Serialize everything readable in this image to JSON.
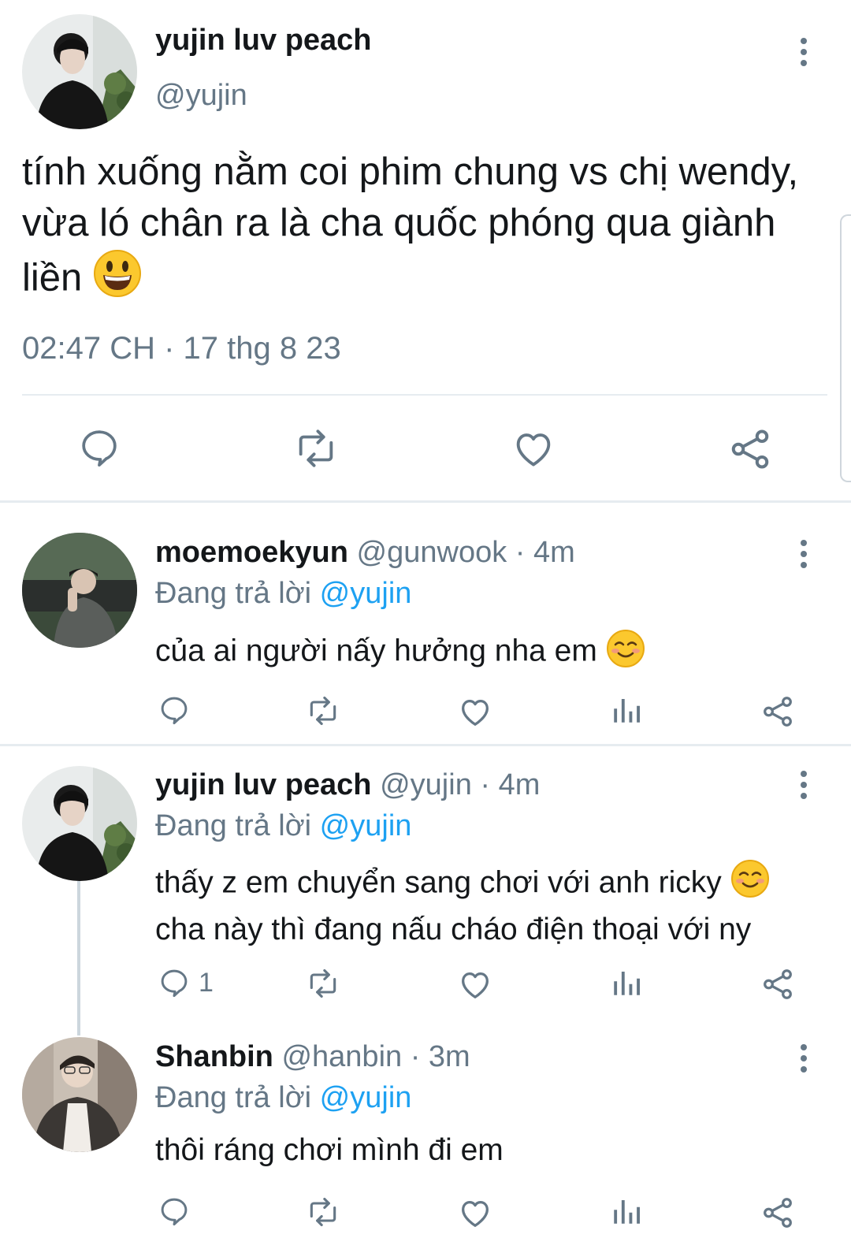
{
  "main_tweet": {
    "display_name": "yujin luv peach",
    "handle": "@yujin",
    "text": "tính xuống nằm coi phim chung vs chị wendy, vừa ló chân ra là cha quốc phóng qua giành liền",
    "emoji": "grinning-face",
    "timestamp": "02:47 CH · 17 thg 8 23"
  },
  "replies": [
    {
      "display_name": "moemoekyun",
      "handle": "@gunwook",
      "time": "· 4m",
      "replying_prefix": "Đang trả lời",
      "replying_to": "@yujin",
      "text": "của ai người nấy hưởng nha em",
      "emoji": "smiling-face",
      "reply_count": ""
    },
    {
      "display_name": "yujin luv peach",
      "handle": "@yujin",
      "time": "· 4m",
      "replying_prefix": "Đang trả lời",
      "replying_to": "@yujin",
      "text_line1": "thấy z em chuyển sang chơi với anh ricky",
      "text_line2": "cha này thì đang nấu cháo điện thoại với ny",
      "emoji": "smiling-face",
      "reply_count": "1"
    },
    {
      "display_name": "Shanbin",
      "handle": "@hanbin",
      "time": "· 3m",
      "replying_prefix": "Đang trả lời",
      "replying_to": "@yujin",
      "text": "thôi ráng chơi mình đi em",
      "reply_count": ""
    }
  ],
  "colors": {
    "text": "#14171a",
    "muted": "#657786",
    "link": "#1da1f2",
    "divider": "#e6ecf0"
  }
}
